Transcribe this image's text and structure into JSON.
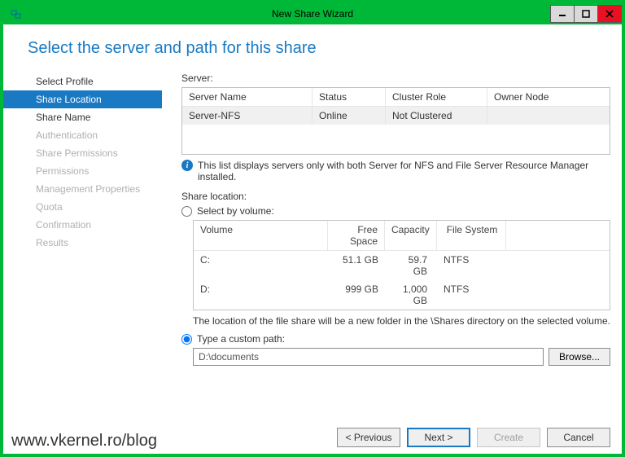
{
  "window": {
    "title": "New Share Wizard"
  },
  "heading": "Select the server and path for this share",
  "nav": {
    "items": [
      {
        "label": "Select Profile",
        "state": "done"
      },
      {
        "label": "Share Location",
        "state": "selected"
      },
      {
        "label": "Share Name",
        "state": "next"
      },
      {
        "label": "Authentication",
        "state": "disabled"
      },
      {
        "label": "Share Permissions",
        "state": "disabled"
      },
      {
        "label": "Permissions",
        "state": "disabled"
      },
      {
        "label": "Management Properties",
        "state": "disabled"
      },
      {
        "label": "Quota",
        "state": "disabled"
      },
      {
        "label": "Confirmation",
        "state": "disabled"
      },
      {
        "label": "Results",
        "state": "disabled"
      }
    ]
  },
  "server": {
    "label": "Server:",
    "columns": {
      "name": "Server Name",
      "status": "Status",
      "cluster": "Cluster Role",
      "owner": "Owner Node"
    },
    "rows": [
      {
        "name": "Server-NFS",
        "status": "Online",
        "cluster": "Not Clustered",
        "owner": ""
      }
    ],
    "info": "This list displays servers only with both Server for NFS and File Server Resource Manager installed."
  },
  "location": {
    "label": "Share location:",
    "radio1": "Select by volume:",
    "radio2": "Type a custom path:",
    "selected": "custom",
    "volumes": {
      "columns": {
        "vol": "Volume",
        "free": "Free Space",
        "cap": "Capacity",
        "fs": "File System"
      },
      "rows": [
        {
          "vol": "C:",
          "free": "51.1 GB",
          "cap": "59.7 GB",
          "fs": "NTFS"
        },
        {
          "vol": "D:",
          "free": "999 GB",
          "cap": "1,000 GB",
          "fs": "NTFS"
        }
      ]
    },
    "hint": "The location of the file share will be a new folder in the \\Shares directory on the selected volume.",
    "path": "D:\\documents",
    "browse": "Browse..."
  },
  "footer": {
    "previous": "< Previous",
    "next": "Next >",
    "create": "Create",
    "cancel": "Cancel"
  },
  "watermark": "www.vkernel.ro/blog"
}
